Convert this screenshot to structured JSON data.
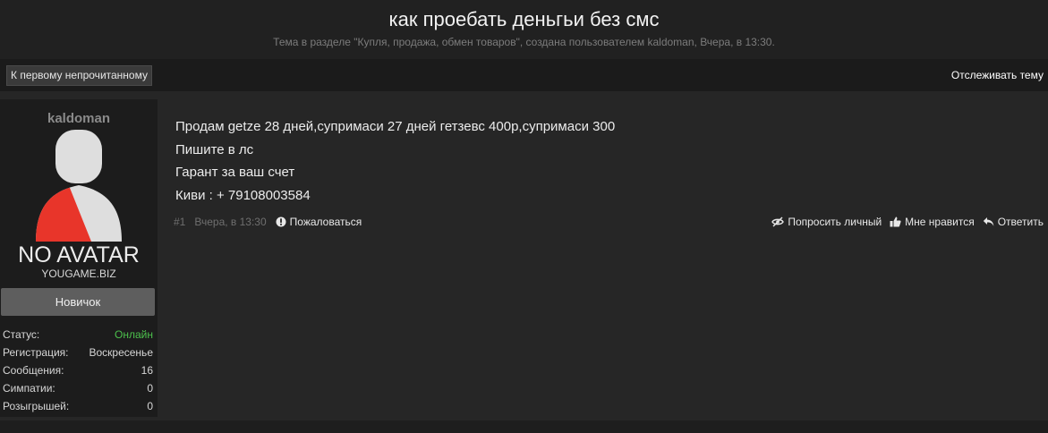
{
  "header": {
    "title": "как проебать деньгьи без смс",
    "subtitle": "Тема в разделе \"Купля, продажа, обмен товаров\", создана пользователем kaldoman, Вчера, в 13:30."
  },
  "topbar": {
    "first_unread_label": "К первому непрочитанному",
    "watch_label": "Отслеживать тему"
  },
  "author": {
    "username": "kaldoman",
    "avatar_text": "NO AVATAR",
    "avatar_site": "YOUGAME.BIZ",
    "rank": "Новичок",
    "stats": [
      {
        "label": "Статус:",
        "value": "Онлайн"
      },
      {
        "label": "Регистрация:",
        "value": "Воскресенье"
      },
      {
        "label": "Сообщения:",
        "value": "16"
      },
      {
        "label": "Симпатии:",
        "value": "0"
      },
      {
        "label": "Розыгрышей:",
        "value": "0"
      }
    ]
  },
  "post": {
    "lines": [
      "Продам getze 28 дней,супримаси 27 дней гетзевс 400р,супримаси 300",
      "Пишите в лс",
      "Гарант за ваш счет",
      "Киви : + 79108003584"
    ],
    "number": "#1",
    "date": "Вчера, в 13:30",
    "report_label": "Пожаловаться",
    "actions": {
      "private_label": "Попросить личный",
      "like_label": "Мне нравится",
      "reply_label": "Ответить"
    }
  },
  "colors": {
    "online": "#4cc04c",
    "avatar_red": "#e8352a"
  }
}
